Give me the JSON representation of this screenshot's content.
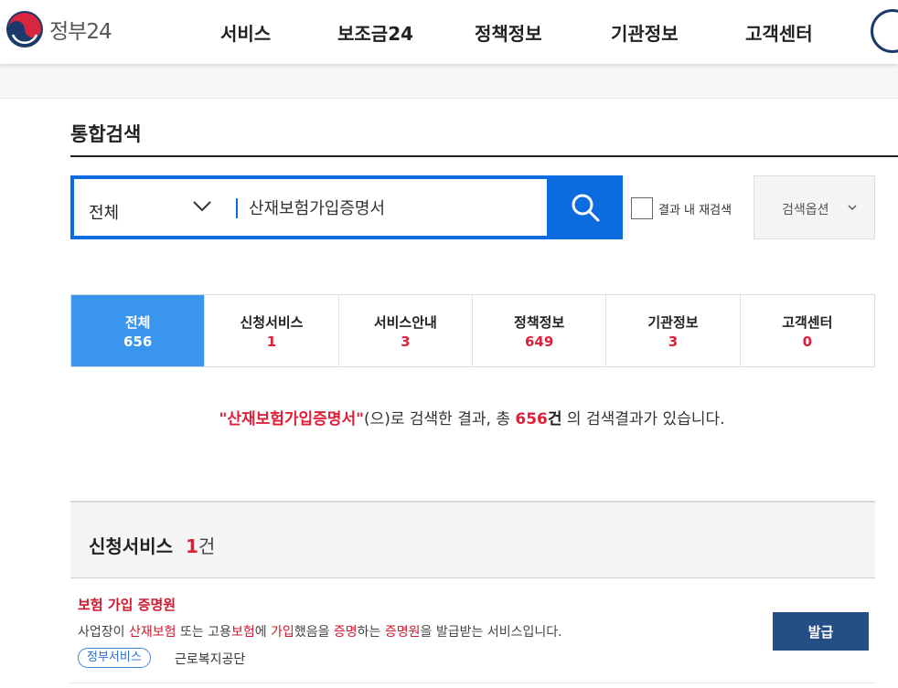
{
  "header": {
    "logo_text": "정부24",
    "nav": [
      {
        "label": "서비스"
      },
      {
        "label": "보조금24"
      },
      {
        "label": "정책정보"
      },
      {
        "label": "기관정보"
      },
      {
        "label": "고객센터"
      }
    ]
  },
  "page": {
    "title": "통합검색"
  },
  "search": {
    "scope_label": "전체",
    "query": "산재보험가입증명서",
    "recheck_label": "결과 내 재검색",
    "options_label": "검색옵션"
  },
  "tabs": [
    {
      "label": "전체",
      "count": "656",
      "active": true
    },
    {
      "label": "신청서비스",
      "count": "1",
      "active": false
    },
    {
      "label": "서비스안내",
      "count": "3",
      "active": false
    },
    {
      "label": "정책정보",
      "count": "649",
      "active": false
    },
    {
      "label": "기관정보",
      "count": "3",
      "active": false
    },
    {
      "label": "고객센터",
      "count": "0",
      "active": false
    }
  ],
  "result_message": {
    "keyword": "\"산재보험가입증명서\"",
    "middle": "(으)로 검색한 결과, 총 ",
    "count": "656",
    "unit": "건",
    "tail": " 의 검색결과가 있습니다."
  },
  "section": {
    "title": "신청서비스",
    "count": "1",
    "unit": "건"
  },
  "items": [
    {
      "title": "보험 가입 증명원",
      "desc_parts": [
        {
          "t": "사업장이 ",
          "hl": false
        },
        {
          "t": "산재보험",
          "hl": true
        },
        {
          "t": " 또는 고용",
          "hl": false
        },
        {
          "t": "보험",
          "hl": true
        },
        {
          "t": "에 ",
          "hl": false
        },
        {
          "t": "가입",
          "hl": true
        },
        {
          "t": "했음을 ",
          "hl": false
        },
        {
          "t": "증명",
          "hl": true
        },
        {
          "t": "하는 ",
          "hl": false
        },
        {
          "t": "증명원",
          "hl": true
        },
        {
          "t": "을 발급받는 서비스입니다.",
          "hl": false
        }
      ],
      "tag": "정부서비스",
      "org": "근로복지공단",
      "button": "발급"
    }
  ],
  "colors": {
    "primary": "#0c6cdf",
    "tab_active": "#3a95ee",
    "highlight": "#e0203a",
    "button_dark": "#254d86"
  }
}
